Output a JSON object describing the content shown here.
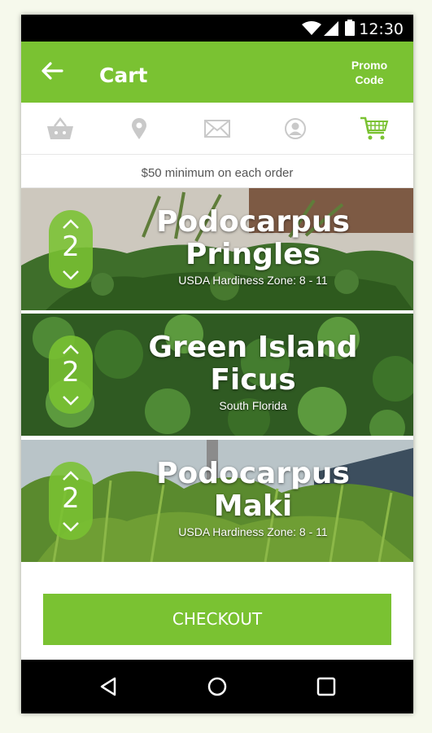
{
  "status_bar": {
    "time": "12:30"
  },
  "app_bar": {
    "title": "Cart",
    "promo_label": "Promo\nCode"
  },
  "tabs": [
    {
      "icon": "basket-icon",
      "active": false
    },
    {
      "icon": "location-pin-icon",
      "active": false
    },
    {
      "icon": "mail-icon",
      "active": false
    },
    {
      "icon": "account-icon",
      "active": false
    },
    {
      "icon": "cart-icon",
      "active": true
    }
  ],
  "notice": "$50 minimum on each order",
  "cart_items": [
    {
      "name": "Podocarpus\nPringles",
      "subtitle": "USDA Hardiness Zone:  8 - 11",
      "quantity": "2"
    },
    {
      "name": "Green Island\nFicus",
      "subtitle": "South Florida",
      "quantity": "2"
    },
    {
      "name": "Podocarpus\nMaki",
      "subtitle": "USDA Hardiness Zone:  8 - 11",
      "quantity": "2"
    }
  ],
  "checkout_label": "CHECKOUT",
  "colors": {
    "accent": "#7ac232",
    "tab_inactive": "#c9c9c9"
  }
}
